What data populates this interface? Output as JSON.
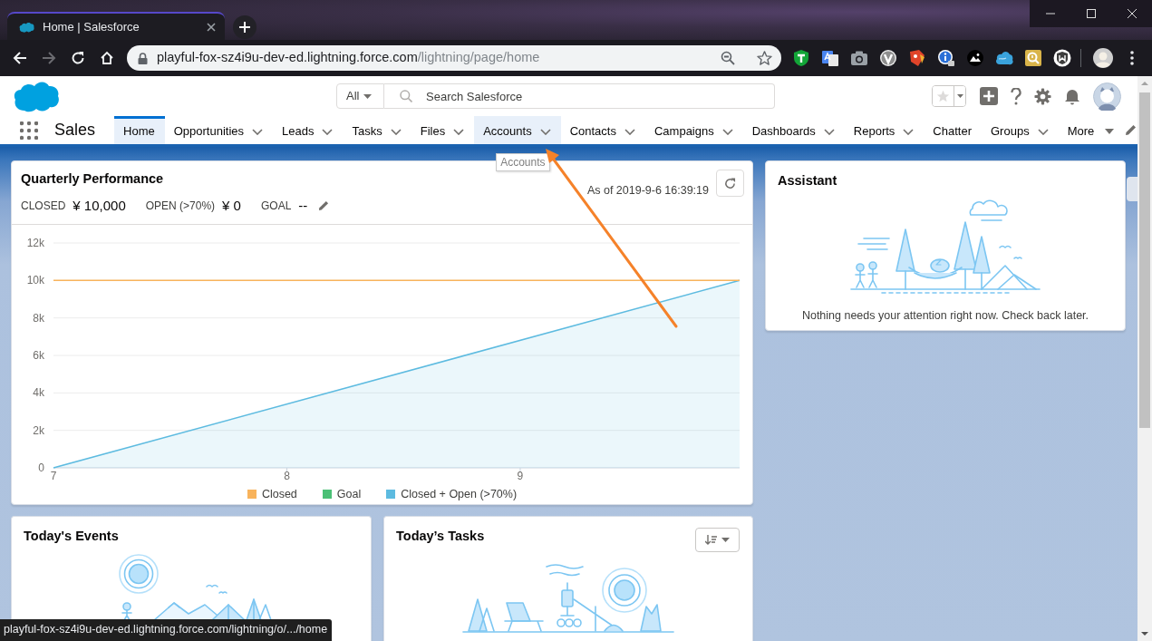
{
  "browser": {
    "tabs": [
      {
        "title": "Home | Salesforce",
        "selected": true
      }
    ],
    "toolbar": {
      "back_disabled": false,
      "forward_disabled": true
    },
    "address": {
      "host": "playful-fox-sz4i9u-dev-ed.lightning.force.com",
      "path": "/lightning/page/home"
    },
    "status_url": "playful-fox-sz4i9u-dev-ed.lightning.force.com/lightning/o/.../home"
  },
  "header": {
    "search": {
      "scope": "All",
      "placeholder": "Search Salesforce"
    }
  },
  "nav": {
    "app_name": "Sales",
    "items": [
      {
        "label": "Home",
        "dropdown": false,
        "selected": true,
        "hovered": false
      },
      {
        "label": "Opportunities",
        "dropdown": true,
        "selected": false,
        "hovered": false
      },
      {
        "label": "Leads",
        "dropdown": true,
        "selected": false,
        "hovered": false
      },
      {
        "label": "Tasks",
        "dropdown": true,
        "selected": false,
        "hovered": false
      },
      {
        "label": "Files",
        "dropdown": true,
        "selected": false,
        "hovered": false
      },
      {
        "label": "Accounts",
        "dropdown": true,
        "selected": false,
        "hovered": true
      },
      {
        "label": "Contacts",
        "dropdown": true,
        "selected": false,
        "hovered": false
      },
      {
        "label": "Campaigns",
        "dropdown": true,
        "selected": false,
        "hovered": false
      },
      {
        "label": "Dashboards",
        "dropdown": true,
        "selected": false,
        "hovered": false
      },
      {
        "label": "Reports",
        "dropdown": true,
        "selected": false,
        "hovered": false
      },
      {
        "label": "Chatter",
        "dropdown": false,
        "selected": false,
        "hovered": false
      },
      {
        "label": "Groups",
        "dropdown": true,
        "selected": false,
        "hovered": false
      }
    ],
    "more": "More",
    "tooltip": "Accounts"
  },
  "quarterly_performance": {
    "title": "Quarterly Performance",
    "stats": [
      {
        "label": "CLOSED",
        "value": "¥ 10,000",
        "editable": false
      },
      {
        "label": "OPEN (>70%)",
        "value": "¥ 0",
        "editable": false
      },
      {
        "label": "GOAL",
        "value": "--",
        "editable": true
      }
    ],
    "as_of": "As of 2019-9-6 16:39:19",
    "chart_data": {
      "type": "line",
      "x": [
        7,
        9.94
      ],
      "series": [
        {
          "name": "Closed",
          "color": "#f8b35c",
          "values": [
            10000,
            10000
          ],
          "type": "line"
        },
        {
          "name": "Goal",
          "color": "#4bc076",
          "values": [
            null,
            null
          ]
        },
        {
          "name": "Closed + Open (>70%)",
          "color": "#5dbbe0",
          "values": [
            0,
            10000
          ],
          "type": "area"
        }
      ],
      "xlim": [
        7,
        9.94
      ],
      "ylim": [
        0,
        12000
      ],
      "xticks": [
        7,
        8,
        9
      ],
      "yticks": [
        {
          "value": 0,
          "label": "0"
        },
        {
          "value": 2000,
          "label": "2k"
        },
        {
          "value": 4000,
          "label": "4k"
        },
        {
          "value": 6000,
          "label": "6k"
        },
        {
          "value": 8000,
          "label": "8k"
        },
        {
          "value": 10000,
          "label": "10k"
        },
        {
          "value": 12000,
          "label": "12k"
        }
      ],
      "grid": true,
      "legend": "bottom"
    }
  },
  "assistant": {
    "title": "Assistant",
    "message": "Nothing needs your attention right now. Check back later."
  },
  "todays_events": {
    "title": "Today's Events"
  },
  "todays_tasks": {
    "title": "Today’s Tasks"
  }
}
